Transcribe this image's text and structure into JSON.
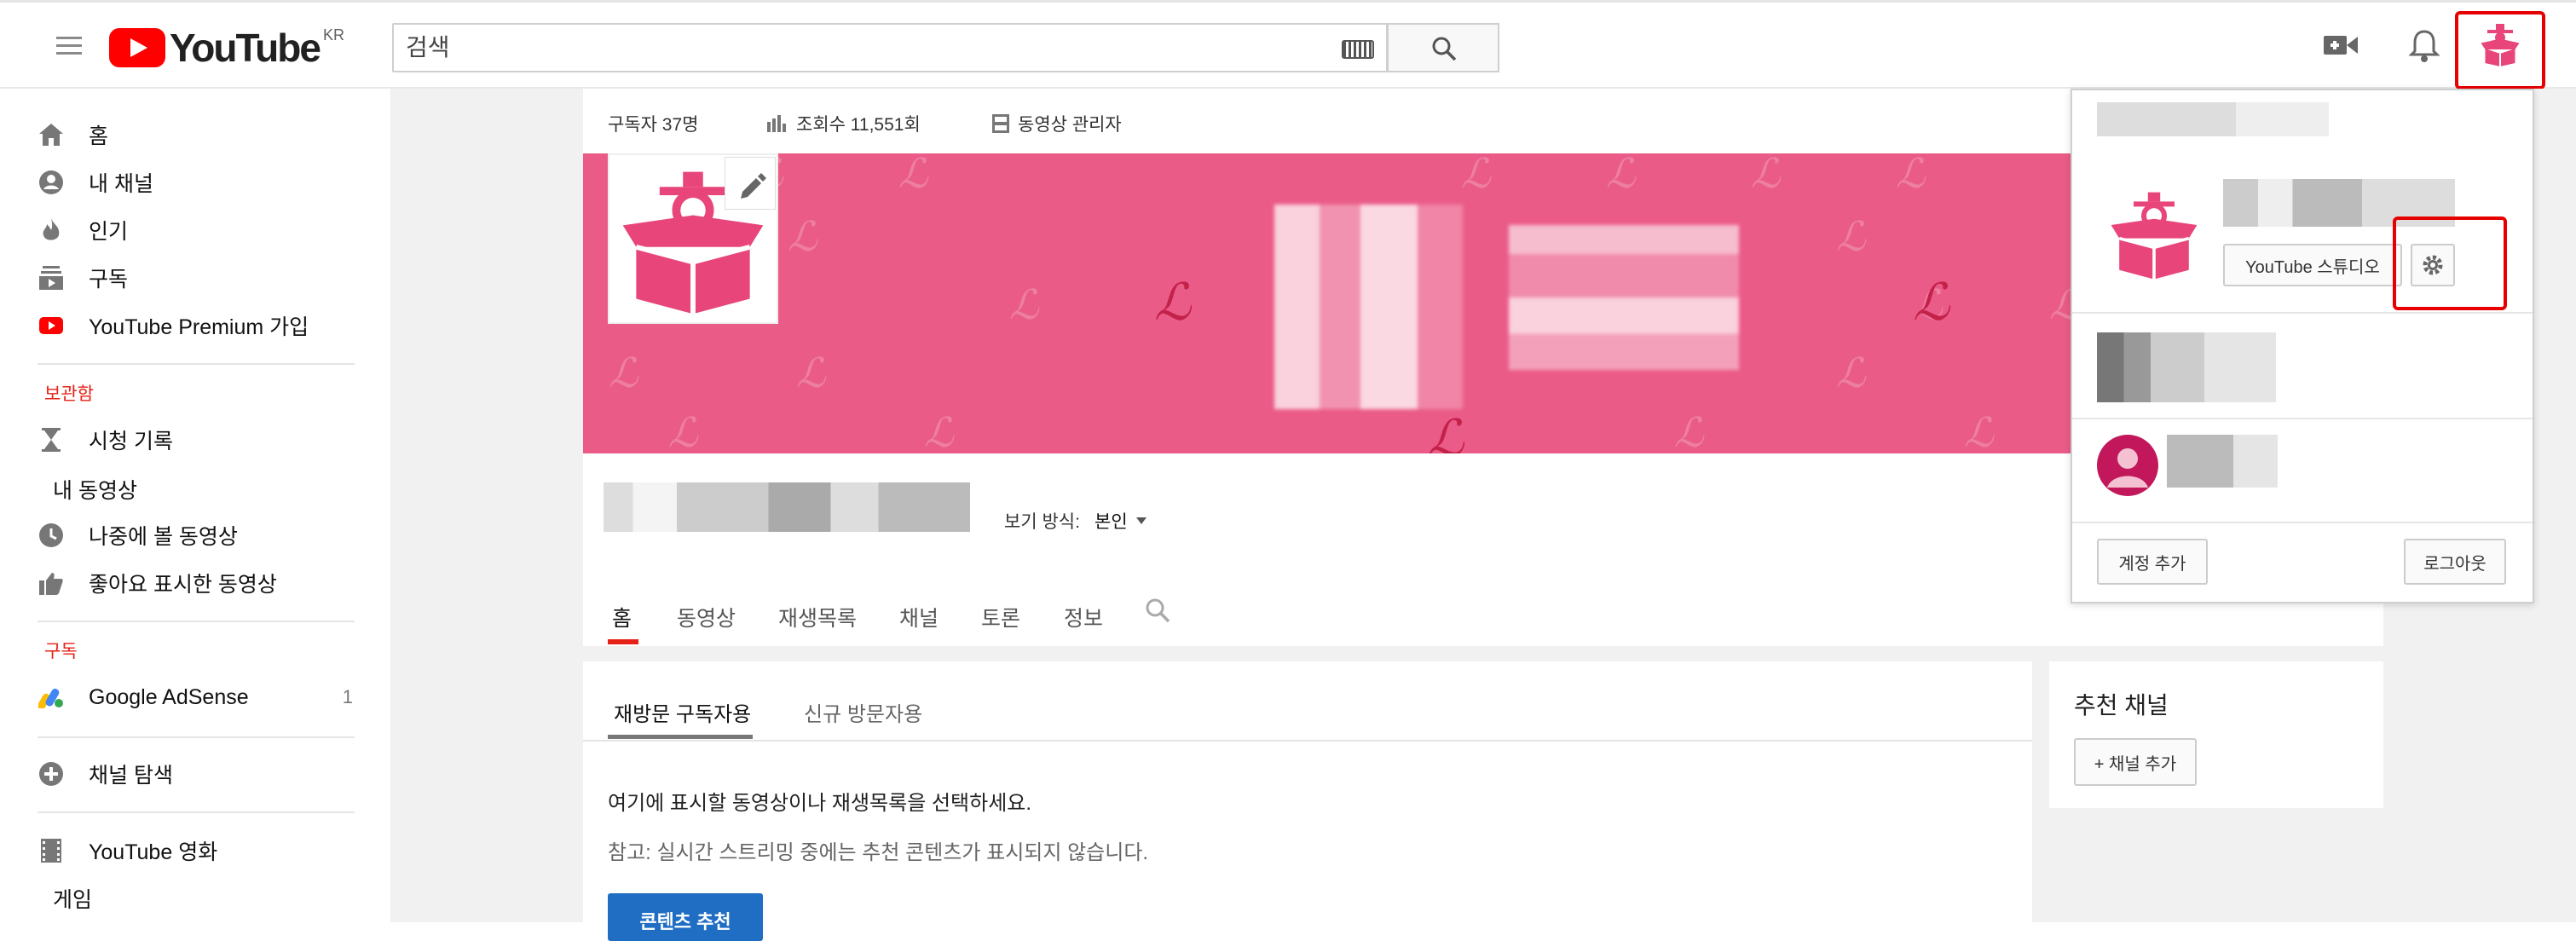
{
  "header": {
    "logo_text": "YouTube",
    "logo_region": "KR",
    "search_placeholder": "검색",
    "icons": [
      "menu-icon",
      "keyboard-icon",
      "search-icon",
      "video-camera-icon",
      "bell-icon",
      "avatar"
    ]
  },
  "sidebar": {
    "top_items": [
      {
        "label": "홈",
        "icon": "home-icon"
      },
      {
        "label": "내 채널",
        "icon": "account-icon"
      },
      {
        "label": "인기",
        "icon": "flame-icon"
      },
      {
        "label": "구독",
        "icon": "subscriptions-icon"
      },
      {
        "label": "YouTube Premium 가입",
        "icon": "youtube-icon"
      }
    ],
    "library_heading": "보관함",
    "library_items": [
      {
        "label": "시청 기록",
        "icon": "hourglass-icon"
      },
      {
        "label": "내 동영상",
        "icon": ""
      },
      {
        "label": "나중에 볼 동영상",
        "icon": "clock-icon"
      },
      {
        "label": "좋아요 표시한 동영상",
        "icon": "thumbs-up-icon"
      }
    ],
    "subs_heading": "구독",
    "subscriptions": [
      {
        "label": "Google AdSense",
        "count": "1",
        "icon": "adsense-icon"
      }
    ],
    "browse_channels": "채널 탐색",
    "youtube_movies": "YouTube 영화",
    "games": "게임"
  },
  "channel": {
    "stats": {
      "subscribers": "구독자 37명",
      "views": "조회수 11,551회",
      "video_manager": "동영상 관리자"
    },
    "view_as_label": "보기 방식:",
    "view_as_value": "본인",
    "tabs": [
      "홈",
      "동영상",
      "재생목록",
      "채널",
      "토론",
      "정보"
    ],
    "active_tab": "홈"
  },
  "content": {
    "subtabs": [
      "재방문 구독자용",
      "신규 방문자용"
    ],
    "active_subtab": "재방문 구독자용",
    "prompt": "여기에 표시할 동영상이나 재생목록을 선택하세요.",
    "note": "참고: 실시간 스트리밍 중에는 추천 콘텐츠가 표시되지 않습니다.",
    "recommend_button": "콘텐츠 추천"
  },
  "recommended": {
    "title": "추천 채널",
    "add_button": "+ 채널 추가"
  },
  "account_panel": {
    "studio_button": "YouTube 스튜디오",
    "add_account": "계정 추가",
    "logout": "로그아웃"
  },
  "colors": {
    "brand_red": "#ff0000",
    "banner_pink": "#ea5b88",
    "highlight_red": "#e60000",
    "button_blue": "#1f6ec4"
  }
}
